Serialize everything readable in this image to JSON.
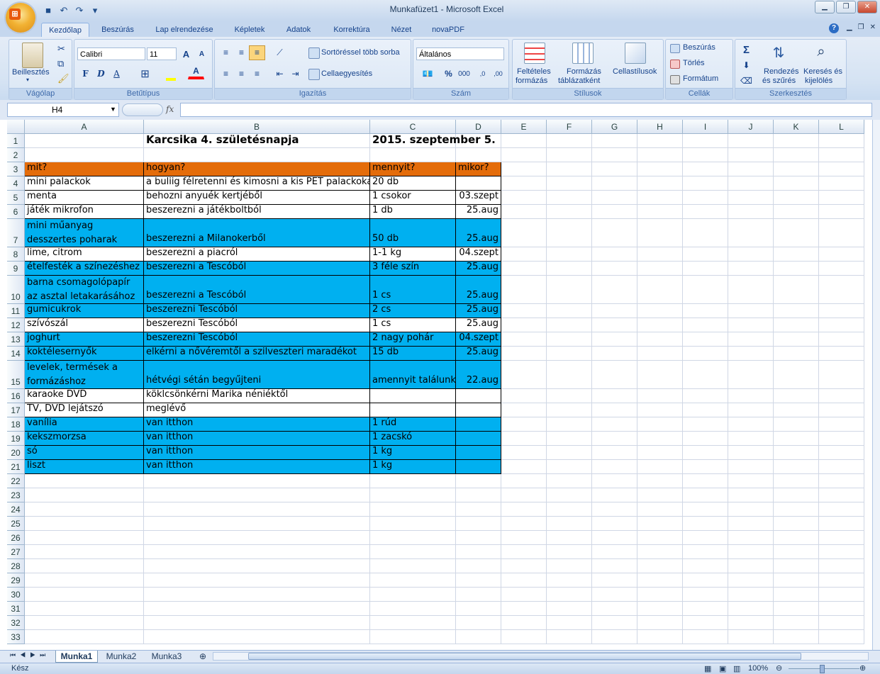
{
  "window": {
    "title": "Munkafüzet1 - Microsoft Excel"
  },
  "quick_access": {
    "icons": [
      "save-icon",
      "undo-icon",
      "redo-icon",
      "customize-icon"
    ]
  },
  "tabs": [
    "Kezdőlap",
    "Beszúrás",
    "Lap elrendezése",
    "Képletek",
    "Adatok",
    "Korrektúra",
    "Nézet",
    "novaPDF"
  ],
  "active_tab": "Kezdőlap",
  "ribbon": {
    "clipboard": {
      "label": "Vágólap",
      "paste": "Beillesztés"
    },
    "font": {
      "label": "Betűtípus",
      "name": "Calibri",
      "size": "11",
      "bold": "F",
      "italic": "D",
      "underline": "A",
      "grow": "A",
      "shrink": "A",
      "font_color": "A"
    },
    "alignment": {
      "label": "Igazítás",
      "wrap": "Sortöréssel több sorba",
      "merge": "Cellaegyesítés"
    },
    "number": {
      "label": "Szám",
      "format": "Általános",
      "percent": "%",
      "thousands": "000",
      "inc": ",0",
      "dec": ",00"
    },
    "styles": {
      "label": "Stílusok",
      "conditional_1": "Feltételes",
      "conditional_2": "formázás",
      "table_1": "Formázás",
      "table_2": "táblázatként",
      "cell": "Cellastílusok"
    },
    "cells": {
      "label": "Cellák",
      "insert": "Beszúrás",
      "delete": "Törlés",
      "format": "Formátum"
    },
    "editing": {
      "label": "Szerkesztés",
      "sigma": "Σ",
      "sort_1": "Rendezés",
      "sort_2": "és szűrés",
      "find_1": "Keresés és",
      "find_2": "kijelölés"
    }
  },
  "formula_bar": {
    "name_box": "H4",
    "fx": "fx",
    "content": ""
  },
  "columns": [
    "A",
    "B",
    "C",
    "D",
    "E",
    "F",
    "G",
    "H",
    "I",
    "J",
    "K",
    "L"
  ],
  "rows": [
    "1",
    "2",
    "3",
    "4",
    "5",
    "6",
    "7",
    "8",
    "9",
    "10",
    "11",
    "12",
    "13",
    "14",
    "15",
    "16",
    "17",
    "18",
    "19",
    "20",
    "21",
    "22",
    "23",
    "24",
    "25",
    "26",
    "27",
    "28",
    "29",
    "30",
    "31",
    "32",
    "33"
  ],
  "sheet": {
    "title": "Karcsika 4. születésnapja",
    "date": "2015. szeptember 5.",
    "headers": [
      "mit?",
      "hogyan?",
      "mennyit?",
      "mikor?"
    ],
    "data_rows": [
      [
        "mini palackok",
        "a buliig félretenni és kimosni a kis PET palackokat",
        "20 db",
        ""
      ],
      [
        "menta",
        "behozni anyuék kertjéből",
        "1 csokor",
        "03.szept"
      ],
      [
        "játék mikrofon",
        "beszerezni a játékboltból",
        "1 db",
        "25.aug"
      ],
      [
        "mini műanyag desszertes poharak",
        "beszerezni a Milanokerből",
        "50 db",
        "25.aug"
      ],
      [
        "lime, citrom",
        "beszerezni a piacról",
        "1-1 kg",
        "04.szept"
      ],
      [
        "ételfesték a színezéshez",
        "beszerezni a Tescóból",
        "3 féle szín",
        "25.aug"
      ],
      [
        "barna csomagolópapír az asztal letakarásához",
        "beszerezni a Tescóból",
        "1 cs",
        "25.aug"
      ],
      [
        "gumicukrok",
        "beszerezni Tescóból",
        "2 cs",
        "25.aug"
      ],
      [
        "szívószál",
        "beszerezni Tescóból",
        "1 cs",
        "25.aug"
      ],
      [
        "joghurt",
        "beszerezni Tescóból",
        "2 nagy pohár",
        "04.szept"
      ],
      [
        "koktélesernyők",
        "elkérni a nővéremtől a szilveszteri maradékot",
        "15 db",
        "25.aug"
      ],
      [
        "levelek, termések a formázáshoz",
        "hétvégi sétán begyűjteni",
        "amennyit találunk",
        "22.aug"
      ],
      [
        "karaoke DVD",
        "köklcsönkérni Marika néniéktől",
        "",
        ""
      ],
      [
        "TV, DVD lejátszó",
        "meglévő",
        "",
        ""
      ],
      [
        "vanília",
        "van itthon",
        "1 rúd",
        ""
      ],
      [
        "kekszmorzsa",
        "van itthon",
        "1 zacskó",
        ""
      ],
      [
        "só",
        "van itthon",
        "1 kg",
        ""
      ],
      [
        "liszt",
        "van itthon",
        "1 kg",
        ""
      ]
    ],
    "row_fill": [
      "white",
      "white",
      "white",
      "blue",
      "white",
      "blue",
      "blue",
      "blue",
      "white",
      "blue",
      "blue",
      "blue",
      "white",
      "white",
      "blue",
      "blue",
      "blue",
      "blue"
    ]
  },
  "colors": {
    "header_orange": "#e46c0a",
    "row_blue": "#00b0f0",
    "ribbon": "#dbe7f5"
  },
  "sheet_tabs": [
    "Munka1",
    "Munka2",
    "Munka3"
  ],
  "active_sheet": "Munka1",
  "status": {
    "ready": "Kész",
    "zoom": "100%"
  }
}
